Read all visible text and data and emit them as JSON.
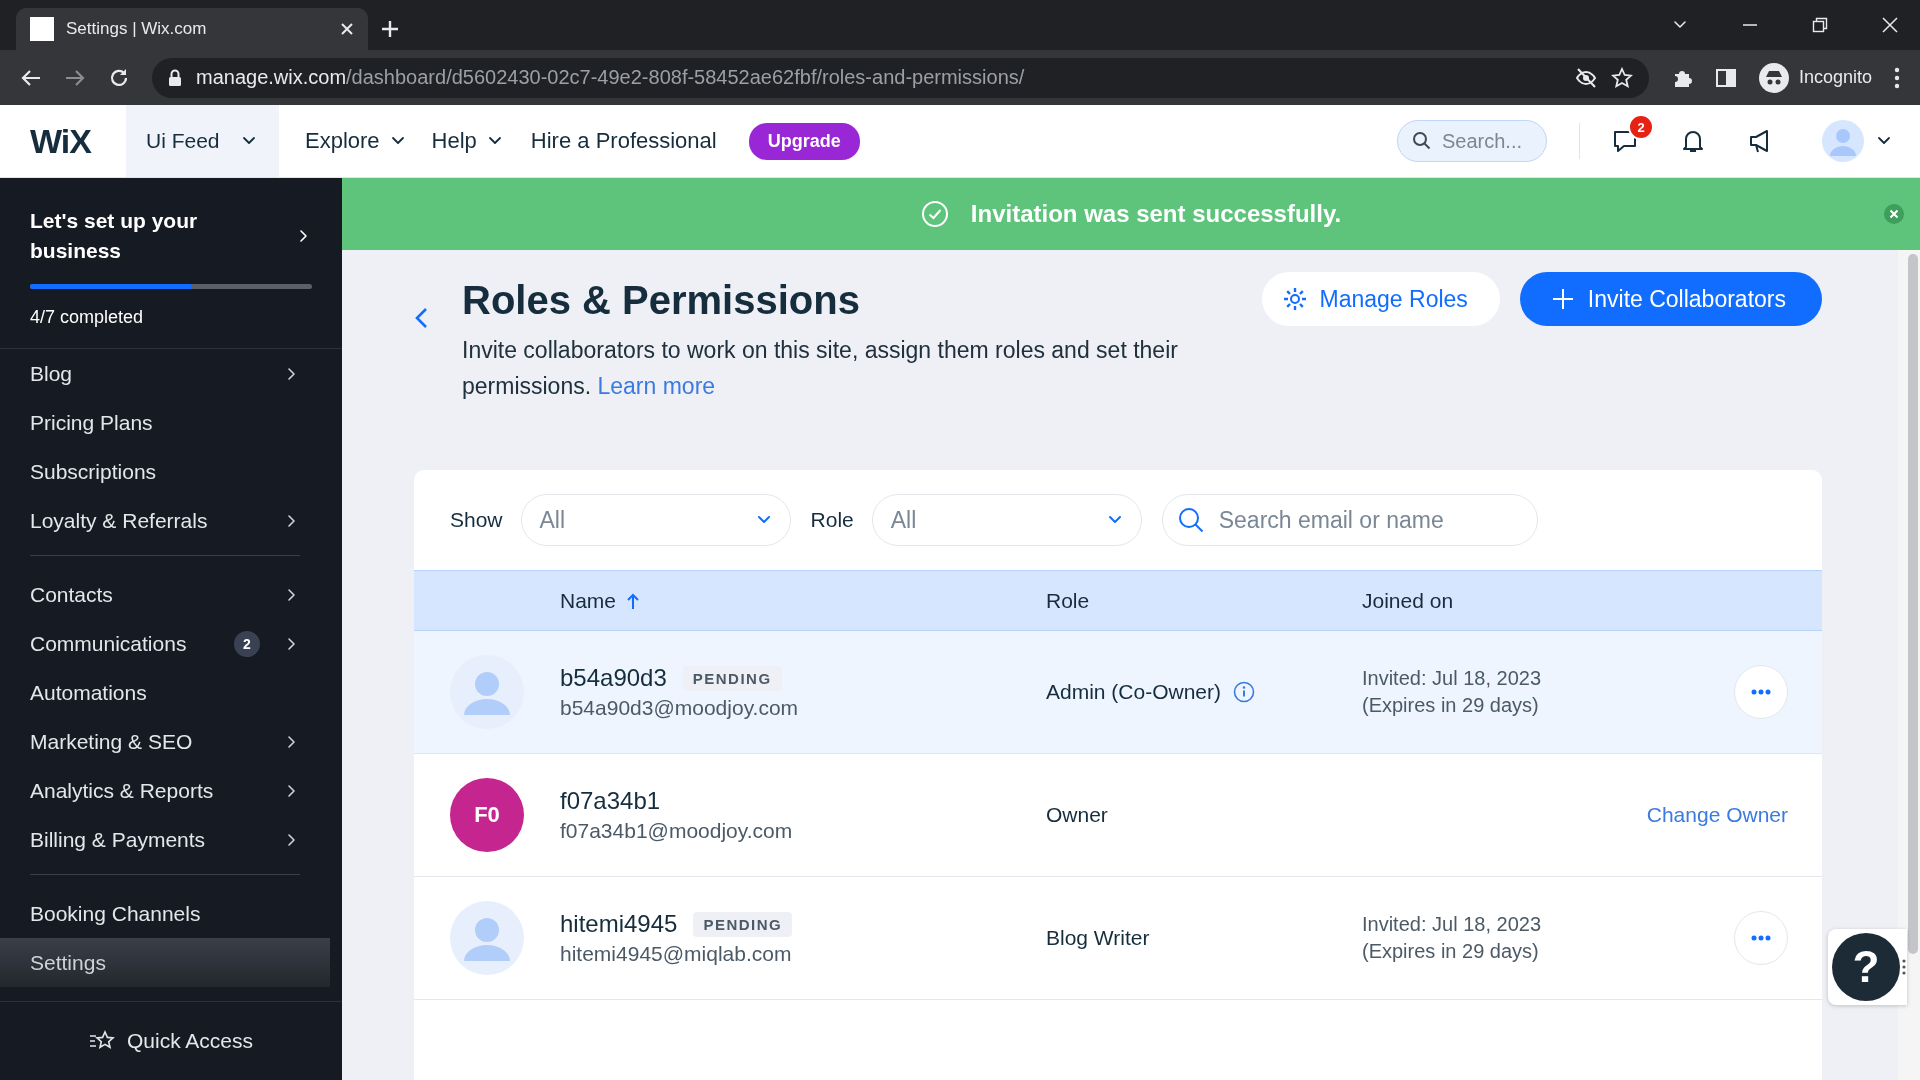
{
  "browser": {
    "tab_title": "Settings | Wix.com",
    "url_host": "manage.wix.com",
    "url_path": "/dashboard/d5602430-02c7-49e2-808f-58452ae62fbf/roles-and-permissions/",
    "profile": "Incognito"
  },
  "topbar": {
    "logo": "WiX",
    "site": "Ui Feed",
    "menus": [
      "Explore",
      "Help"
    ],
    "link": "Hire a Professional",
    "upgrade": "Upgrade",
    "search_placeholder": "Search...",
    "messages_badge": "2"
  },
  "sidebar": {
    "setup": {
      "title": "Let's set up your business",
      "level": 0.57,
      "status": "4/7 completed"
    },
    "items": [
      {
        "kind": "item",
        "label": "Blog",
        "chevron": true,
        "selected": false
      },
      {
        "kind": "item",
        "label": "Pricing Plans",
        "chevron": false,
        "selected": false
      },
      {
        "kind": "item",
        "label": "Subscriptions",
        "chevron": false,
        "selected": false
      },
      {
        "kind": "item",
        "label": "Loyalty & Referrals",
        "chevron": true,
        "selected": false
      },
      {
        "kind": "divider"
      },
      {
        "kind": "item",
        "label": "Contacts",
        "chevron": true,
        "selected": false
      },
      {
        "kind": "item",
        "label": "Communications",
        "badge": "2",
        "chevron": true,
        "selected": false
      },
      {
        "kind": "item",
        "label": "Automations",
        "chevron": false,
        "selected": false
      },
      {
        "kind": "item",
        "label": "Marketing & SEO",
        "chevron": true,
        "selected": false
      },
      {
        "kind": "item",
        "label": "Analytics & Reports",
        "chevron": true,
        "selected": false
      },
      {
        "kind": "item",
        "label": "Billing & Payments",
        "chevron": true,
        "selected": false
      },
      {
        "kind": "divider"
      },
      {
        "kind": "item",
        "label": "Booking Channels",
        "chevron": false,
        "selected": false
      },
      {
        "kind": "item",
        "label": "Settings",
        "chevron": false,
        "selected": true
      }
    ],
    "footer": "Quick Access"
  },
  "banner": {
    "text": "Invitation was sent successfully."
  },
  "page": {
    "title": "Roles & Permissions",
    "description": "Invite collaborators to work on this site, assign them roles and set their permissions.",
    "learn_more": "Learn more",
    "manage_button": "Manage Roles",
    "invite_button": "Invite Collaborators"
  },
  "filters": {
    "show_label": "Show",
    "show_value": "All",
    "role_label": "Role",
    "role_value": "All",
    "search_placeholder": "Search email or name"
  },
  "columns": [
    {
      "label": "Name",
      "sorted": true
    },
    {
      "label": "Role",
      "sorted": false
    },
    {
      "label": "Joined on",
      "sorted": false
    }
  ],
  "rows": [
    {
      "avatar": {
        "kind": "placeholder"
      },
      "name": "b54a90d3",
      "status": "PENDING",
      "email": "b54a90d3@moodjoy.com",
      "role": "Admin (Co-Owner)",
      "info": true,
      "joined": [
        "Invited: Jul 18, 2023",
        "(Expires in 29 days)"
      ],
      "action": {
        "kind": "menu"
      },
      "highlighted": true
    },
    {
      "avatar": {
        "kind": "initials",
        "initials": "F0",
        "color": "#c4258f"
      },
      "name": "f07a34b1",
      "email": "f07a34b1@moodjoy.com",
      "role": "Owner",
      "info": false,
      "action": {
        "kind": "link",
        "label": "Change Owner"
      },
      "highlighted": false
    },
    {
      "avatar": {
        "kind": "placeholder"
      },
      "name": "hitemi4945",
      "status": "PENDING",
      "email": "hitemi4945@miqlab.com",
      "role": "Blog Writer",
      "info": false,
      "joined": [
        "Invited: Jul 18, 2023",
        "(Expires in 29 days)"
      ],
      "action": {
        "kind": "menu"
      },
      "highlighted": false
    }
  ],
  "help": {
    "label": "?"
  }
}
